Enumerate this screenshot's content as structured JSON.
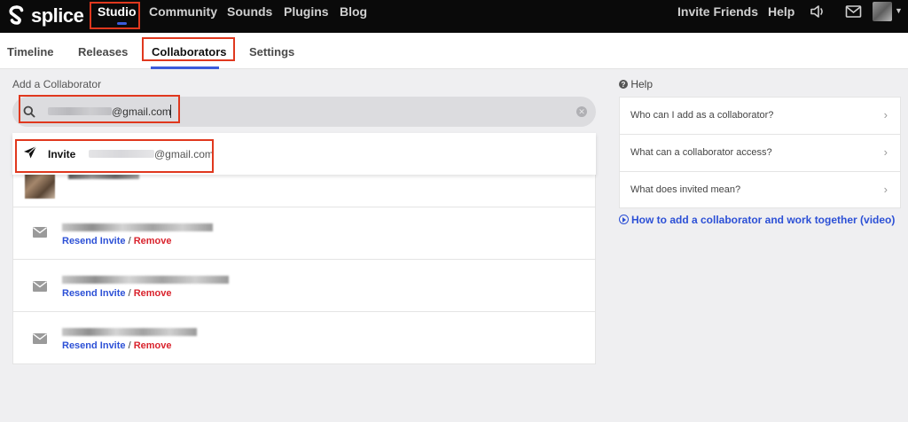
{
  "brand": {
    "name": "splice"
  },
  "nav": {
    "items": [
      {
        "label": "Studio",
        "active": true
      },
      {
        "label": "Community"
      },
      {
        "label": "Sounds"
      },
      {
        "label": "Plugins"
      },
      {
        "label": "Blog"
      }
    ],
    "right": {
      "invite_friends": "Invite Friends",
      "help": "Help",
      "icons": [
        "speaker-icon",
        "mail-icon",
        "avatar",
        "chevron-down-icon"
      ]
    }
  },
  "tabs": [
    {
      "label": "Timeline"
    },
    {
      "label": "Releases"
    },
    {
      "label": "Collaborators",
      "active": true
    },
    {
      "label": "Settings"
    }
  ],
  "add_collaborator": {
    "section_label": "Add a Collaborator",
    "search_value": "@gmail.com",
    "suggestion": {
      "action_label": "Invite",
      "email": "@gmail.com"
    }
  },
  "collaborators": [
    {
      "type": "user",
      "name_blurred": true
    },
    {
      "type": "invite",
      "email_blurred": true,
      "resend_label": "Resend Invite",
      "separator": "/",
      "remove_label": "Remove"
    },
    {
      "type": "invite",
      "email_blurred": true,
      "resend_label": "Resend Invite",
      "separator": "/",
      "remove_label": "Remove"
    },
    {
      "type": "invite",
      "email_blurred": true,
      "resend_label": "Resend Invite",
      "separator": "/",
      "remove_label": "Remove"
    }
  ],
  "help": {
    "title": "Help",
    "items": [
      {
        "label": "Who can I add as a collaborator?"
      },
      {
        "label": "What can a collaborator access?"
      },
      {
        "label": "What does invited mean?"
      }
    ],
    "video_link": "How to add a collaborator and work together (video)"
  },
  "colors": {
    "nav_bg": "#0a0a0a",
    "accent": "#3b5bdb",
    "link_blue": "#2c50d6",
    "remove_red": "#d9232d",
    "annotation_red": "#e0381e",
    "page_bg": "#efeff1"
  }
}
